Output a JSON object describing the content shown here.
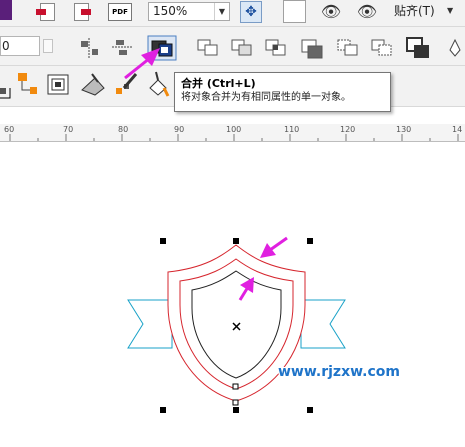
{
  "toolbar": {
    "zoom_value": "150%",
    "snap_label": "贴齐(T)",
    "position_value": "0"
  },
  "tooltip": {
    "title": "合并 (Ctrl+L)",
    "description": "将对象合并为有相同属性的单一对象。"
  },
  "ruler": {
    "ticks": [
      "60",
      "70",
      "80",
      "90",
      "100",
      "110",
      "120",
      "130",
      "14"
    ]
  },
  "watermark": "www.rjzxw.com",
  "colors": {
    "shield_outline": "#d6262e",
    "ribbon": "#19a2c8",
    "arrow": "#e020e0",
    "watermark": "#1f74c9"
  },
  "icons": {
    "combine": "combine-icon",
    "pdf": "pdf-export-icon"
  }
}
